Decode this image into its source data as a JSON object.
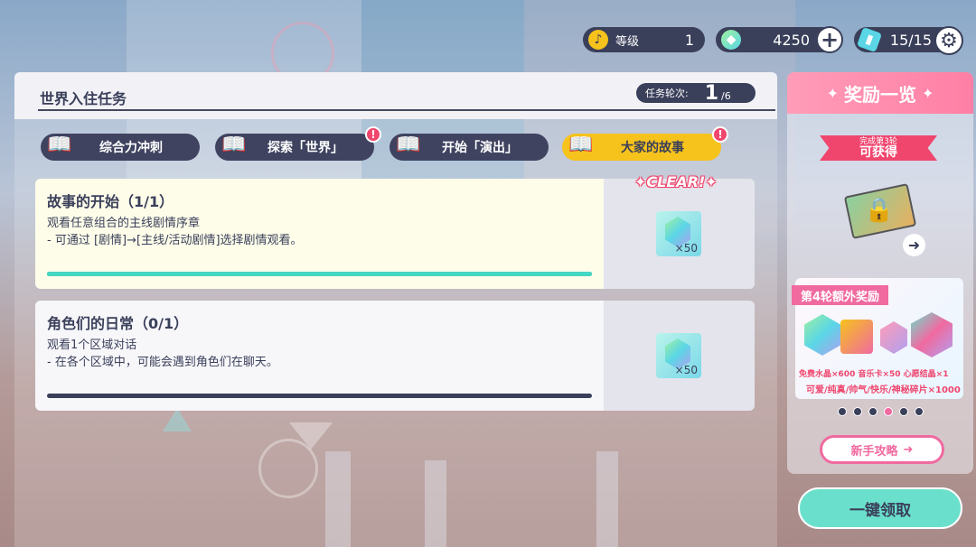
{
  "status_bar": {
    "level_label": "等级",
    "level_value": "1",
    "gem_value": "4250",
    "plus_symbol": "+",
    "energy_value": "15/15"
  },
  "mission": {
    "title": "世界入住任务",
    "round_label": "任务轮次:",
    "round_current": "1",
    "round_total": "/6"
  },
  "tabs": [
    {
      "label": "综合力冲刺",
      "active": false,
      "badge": false
    },
    {
      "label": "探索「世界」",
      "active": false,
      "badge": true
    },
    {
      "label": "开始「演出」",
      "active": false,
      "badge": false
    },
    {
      "label": "大家的故事",
      "active": true,
      "badge": true
    }
  ],
  "badge_symbol": "!",
  "tasks": [
    {
      "title": "故事的开始（1/1）",
      "desc_line1": "观看任意组合的主线剧情序章",
      "desc_line2": "- 可通过 [剧情]→[主线/活动剧情]选择剧情观看。",
      "reward_qty": "×50",
      "progress": 1.0,
      "cleared": true
    },
    {
      "title": "角色们的日常（0/1）",
      "desc_line1": "观看1个区域对话",
      "desc_line2": "- 在各个区域中，可能会遇到角色们在聊天。",
      "reward_qty": "×50",
      "progress": 0.0,
      "cleared": false
    }
  ],
  "clear_stamp": "✦CLEAR!✦",
  "side": {
    "header": "奖励一览",
    "ribbon_small": "完成第3轮",
    "ribbon_big": "可获得",
    "bonus_title": "第4轮额外奖励",
    "bonus_line1": "免费水晶×600   音乐卡×50   心愿结晶×1",
    "bonus_line2": "可爱/纯真/帅气/快乐/神秘碎片×1000",
    "page_dots": 6,
    "active_dot": 3,
    "guide_label": "新手攻略",
    "claim_label": "一键领取"
  },
  "colors": {
    "accent_dark": "#3a3f5a",
    "tab_active": "#f6c21c",
    "progress": "#44d8c4",
    "pink": "#f0466e",
    "claim": "#6ae0cc"
  }
}
